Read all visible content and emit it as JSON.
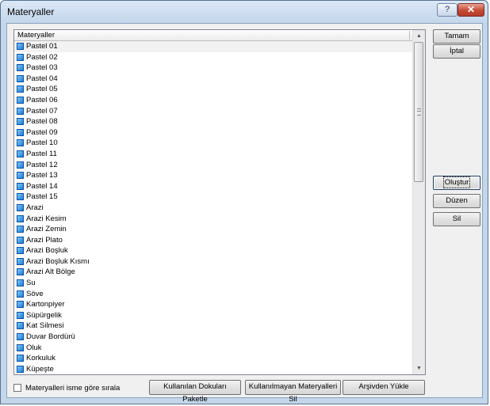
{
  "window": {
    "title": "Materyaller",
    "help_glyph": "?",
    "close_glyph": "✕"
  },
  "list": {
    "header": "Materyaller",
    "items": [
      "Pastel 01",
      "Pastel 02",
      "Pastel 03",
      "Pastel 04",
      "Pastel 05",
      "Pastel 06",
      "Pastel 07",
      "Pastel 08",
      "Pastel 09",
      "Pastel 10",
      "Pastel 11",
      "Pastel 12",
      "Pastel 13",
      "Pastel 14",
      "Pastel 15",
      "Arazi",
      "Arazi Kesim",
      "Arazi Zemin",
      "Arazi Plato",
      "Arazi Boşluk",
      "Arazi Boşluk Kısmı",
      "Arazi Alt Bölge",
      "Su",
      "Söve",
      "Kartonpiyer",
      "Süpürgelik",
      "Kat Silmesi",
      "Duvar Bordürü",
      "Oluk",
      "Korkuluk",
      "Küpeşte"
    ],
    "selected_index": 0,
    "scroll_up": "▲",
    "scroll_down": "▼"
  },
  "buttons": {
    "ok": "Tamam",
    "cancel": "İptal",
    "create": "Oluştur",
    "edit": "Düzen",
    "delete": "Sil",
    "package_used": "Kullanılan Dokuları Paketle",
    "delete_unused": "Kullanılmayan Materyalleri Sil",
    "load_archive": "Arşivden Yükle"
  },
  "options": {
    "sort_by_name_label": "Materyalleri isme göre sırala",
    "sort_by_name_checked": false
  },
  "icons": {
    "help": "help-icon",
    "close": "close-icon",
    "material": "material-cube-icon"
  }
}
